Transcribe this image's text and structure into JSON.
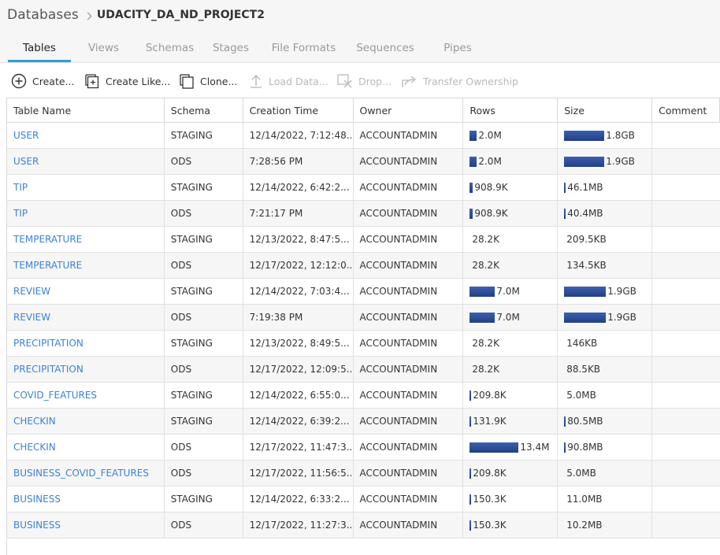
{
  "breadcrumb": {
    "root": "Databases",
    "database": "UDACITY_DA_ND_PROJECT2"
  },
  "tabs": [
    {
      "label": "Tables",
      "active": true
    },
    {
      "label": "Views",
      "active": false
    },
    {
      "label": "Schemas",
      "active": false
    },
    {
      "label": "Stages",
      "active": false
    },
    {
      "label": "File Formats",
      "active": false
    },
    {
      "label": "Sequences",
      "active": false
    },
    {
      "label": "Pipes",
      "active": false
    }
  ],
  "toolbar": {
    "create": "Create...",
    "create_like": "Create Like...",
    "clone": "Clone...",
    "load_data": "Load Data...",
    "drop": "Drop...",
    "transfer_ownership": "Transfer Ownership"
  },
  "columns": {
    "name": "Table Name",
    "schema": "Schema",
    "created": "Creation Time",
    "owner": "Owner",
    "rows": "Rows",
    "size": "Size",
    "comment": "Comment"
  },
  "tables": [
    {
      "name": "USER",
      "schema": "STAGING",
      "created": "12/14/2022, 7:12:48...",
      "owner": "ACCOUNTADMIN",
      "rows": "2.0M",
      "rows_level": 0.15,
      "size": "1.8GB",
      "size_level": 0.97
    },
    {
      "name": "USER",
      "schema": "ODS",
      "created": "7:28:56 PM",
      "owner": "ACCOUNTADMIN",
      "rows": "2.0M",
      "rows_level": 0.15,
      "size": "1.9GB",
      "size_level": 0.97
    },
    {
      "name": "TIP",
      "schema": "STAGING",
      "created": "12/14/2022, 6:42:2...",
      "owner": "ACCOUNTADMIN",
      "rows": "908.9K",
      "rows_level": 0.068,
      "size": "46.1MB",
      "size_level": 0.024
    },
    {
      "name": "TIP",
      "schema": "ODS",
      "created": "7:21:17 PM",
      "owner": "ACCOUNTADMIN",
      "rows": "908.9K",
      "rows_level": 0.068,
      "size": "40.4MB",
      "size_level": 0.021
    },
    {
      "name": "TEMPERATURE",
      "schema": "STAGING",
      "created": "12/13/2022, 8:47:5...",
      "owner": "ACCOUNTADMIN",
      "rows": "28.2K",
      "rows_level": 0.002,
      "size": "209.5KB",
      "size_level": 0.0001
    },
    {
      "name": "TEMPERATURE",
      "schema": "ODS",
      "created": "12/17/2022, 12:12:0...",
      "owner": "ACCOUNTADMIN",
      "rows": "28.2K",
      "rows_level": 0.002,
      "size": "134.5KB",
      "size_level": 0.0001
    },
    {
      "name": "REVIEW",
      "schema": "STAGING",
      "created": "12/14/2022, 7:03:4...",
      "owner": "ACCOUNTADMIN",
      "rows": "7.0M",
      "rows_level": 0.52,
      "size": "1.9GB",
      "size_level": 1.0
    },
    {
      "name": "REVIEW",
      "schema": "ODS",
      "created": "7:19:38 PM",
      "owner": "ACCOUNTADMIN",
      "rows": "7.0M",
      "rows_level": 0.52,
      "size": "1.9GB",
      "size_level": 1.0
    },
    {
      "name": "PRECIPITATION",
      "schema": "STAGING",
      "created": "12/13/2022, 8:49:5...",
      "owner": "ACCOUNTADMIN",
      "rows": "28.2K",
      "rows_level": 0.002,
      "size": "146KB",
      "size_level": 0.0001
    },
    {
      "name": "PRECIPITATION",
      "schema": "ODS",
      "created": "12/17/2022, 12:09:5...",
      "owner": "ACCOUNTADMIN",
      "rows": "28.2K",
      "rows_level": 0.002,
      "size": "88.5KB",
      "size_level": 0.0
    },
    {
      "name": "COVID_FEATURES",
      "schema": "STAGING",
      "created": "12/14/2022, 6:55:0...",
      "owner": "ACCOUNTADMIN",
      "rows": "209.8K",
      "rows_level": 0.016,
      "size": "5.0MB",
      "size_level": 0.003
    },
    {
      "name": "CHECKIN",
      "schema": "STAGING",
      "created": "12/14/2022, 6:39:2...",
      "owner": "ACCOUNTADMIN",
      "rows": "131.9K",
      "rows_level": 0.01,
      "size": "80.5MB",
      "size_level": 0.042
    },
    {
      "name": "CHECKIN",
      "schema": "ODS",
      "created": "12/17/2022, 11:47:3...",
      "owner": "ACCOUNTADMIN",
      "rows": "13.4M",
      "rows_level": 1.0,
      "size": "90.8MB",
      "size_level": 0.047
    },
    {
      "name": "BUSINESS_COVID_FEATURES",
      "schema": "ODS",
      "created": "12/17/2022, 11:56:5...",
      "owner": "ACCOUNTADMIN",
      "rows": "209.8K",
      "rows_level": 0.016,
      "size": "5.0MB",
      "size_level": 0.003
    },
    {
      "name": "BUSINESS",
      "schema": "STAGING",
      "created": "12/14/2022, 6:33:2...",
      "owner": "ACCOUNTADMIN",
      "rows": "150.3K",
      "rows_level": 0.011,
      "size": "11.0MB",
      "size_level": 0.006
    },
    {
      "name": "BUSINESS",
      "schema": "ODS",
      "created": "12/17/2022, 11:27:3...",
      "owner": "ACCOUNTADMIN",
      "rows": "150.3K",
      "rows_level": 0.011,
      "size": "10.2MB",
      "size_level": 0.005
    }
  ],
  "colors": {
    "link": "#3c82d6",
    "bar": "#2b4a94",
    "active_tab": "#2e9fd6"
  }
}
